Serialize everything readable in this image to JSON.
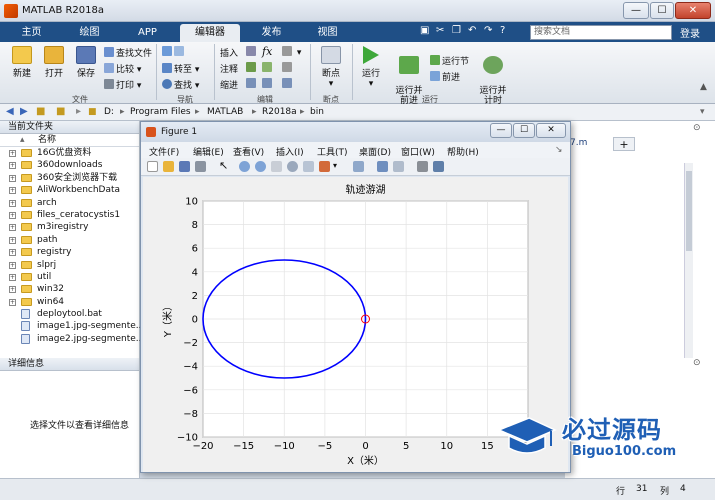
{
  "app": {
    "title": "MATLAB R2018a",
    "search_placeholder": "搜索文档",
    "login": "登录"
  },
  "window_buttons": {
    "minimize": "—",
    "maximize": "☐",
    "close": "✕"
  },
  "tabs": [
    {
      "label": "主页"
    },
    {
      "label": "绘图"
    },
    {
      "label": "APP"
    },
    {
      "label": "编辑器"
    },
    {
      "label": "发布"
    },
    {
      "label": "视图"
    }
  ],
  "ribbon": {
    "file": {
      "new": "新建",
      "open": "打开",
      "save": "保存",
      "find_files": "查找文件",
      "compare": "比较",
      "print": "打印",
      "group": "文件"
    },
    "nav": {
      "goto": "转至",
      "find": "查找",
      "group": "导航"
    },
    "edit": {
      "insert": "插入",
      "comment": "注释",
      "indent": "缩进",
      "fx": "fx",
      "group": "编辑"
    },
    "breakpoint": {
      "label": "断点",
      "group": "断点"
    },
    "run": {
      "run": "运行",
      "run_advance": "运行并\n前进",
      "run_section": "运行节",
      "advance": "前进",
      "run_time": "运行并\n计时",
      "group": "运行"
    }
  },
  "address": {
    "crumbs": [
      "D:",
      "Program Files",
      "MATLAB",
      "R2018a",
      "bin"
    ]
  },
  "current_folder": {
    "header": "当前文件夹",
    "column": "名称",
    "items": [
      {
        "name": "16G优盘资料",
        "type": "folder"
      },
      {
        "name": "360downloads",
        "type": "folder"
      },
      {
        "name": "360安全浏览器下载",
        "type": "folder"
      },
      {
        "name": "AliWorkbenchData",
        "type": "folder"
      },
      {
        "name": "arch",
        "type": "folder"
      },
      {
        "name": "files_ceratocystis1",
        "type": "folder"
      },
      {
        "name": "m3iregistry",
        "type": "folder"
      },
      {
        "name": "path",
        "type": "folder"
      },
      {
        "name": "registry",
        "type": "folder"
      },
      {
        "name": "slprj",
        "type": "folder"
      },
      {
        "name": "util",
        "type": "folder"
      },
      {
        "name": "win32",
        "type": "folder"
      },
      {
        "name": "win64",
        "type": "folder"
      },
      {
        "name": "deploytool.bat",
        "type": "file"
      },
      {
        "name": "image1.jpg-segmente...",
        "type": "file"
      },
      {
        "name": "image2.jpg-segmente...",
        "type": "file"
      }
    ]
  },
  "details": {
    "header": "详细信息",
    "hint": "选择文件以查看详细信息"
  },
  "editor": {
    "tab_fragment": "7.m",
    "add_tab": "+"
  },
  "status": {
    "row_label": "行",
    "row": "31",
    "col_label": "列",
    "col": "4"
  },
  "figure": {
    "title": "Figure 1",
    "menu": [
      "文件(F)",
      "编辑(E)",
      "查看(V)",
      "插入(I)",
      "工具(T)",
      "桌面(D)",
      "窗口(W)",
      "帮助(H)"
    ]
  },
  "chart_data": {
    "type": "line",
    "title": "轨迹游湖",
    "xlabel": "X（米）",
    "ylabel": "Y（米）",
    "xlim": [
      -20,
      20
    ],
    "ylim": [
      -10,
      10
    ],
    "xticks": [
      -20,
      -15,
      -10,
      -5,
      0,
      5,
      10,
      15,
      20
    ],
    "yticks": [
      -10,
      -8,
      -6,
      -4,
      -2,
      0,
      2,
      4,
      6,
      8,
      10
    ],
    "grid": true,
    "series": [
      {
        "shape": "ellipse",
        "center": [
          -10,
          0
        ],
        "radius_x": 10,
        "radius_y": 5,
        "color": "#0000ff"
      }
    ],
    "marker": {
      "x": 0,
      "y": 0,
      "shape": "circle",
      "color": "#ff0000"
    }
  },
  "watermark": {
    "big": "必过源码",
    "small": "Biguo100.com"
  },
  "colors": {
    "ribbon_tab_bg": "#1f4f86",
    "accent": "#1f5fb5",
    "curve": "#0000ff"
  }
}
